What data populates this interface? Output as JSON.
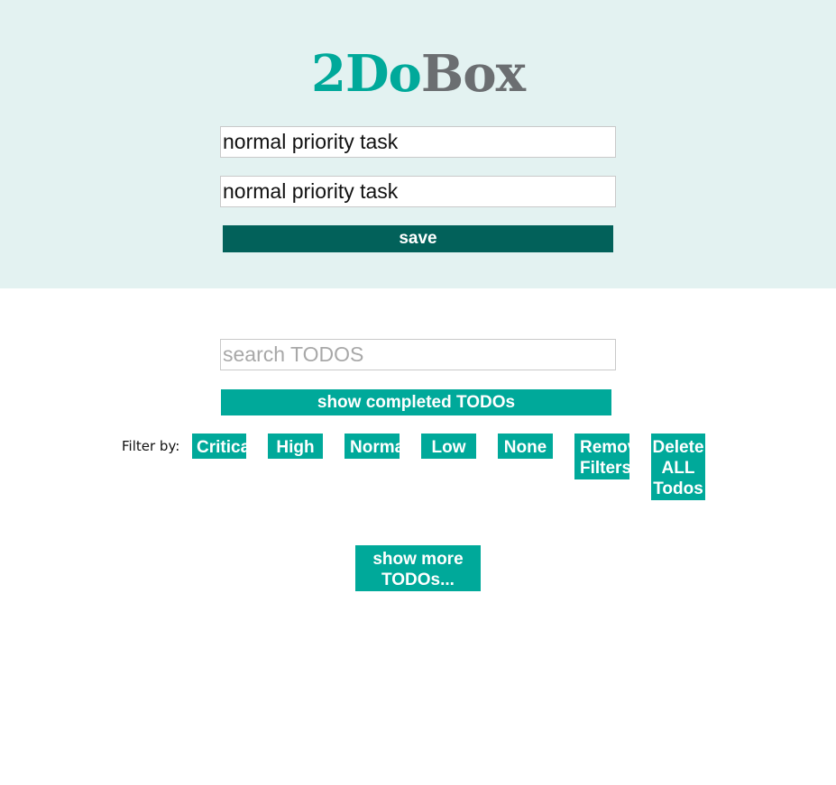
{
  "header": {
    "logo_part_a": "2Do",
    "logo_part_b": "Box",
    "title_value": "normal priority task",
    "body_value": "normal priority task",
    "save_label": "save"
  },
  "search": {
    "placeholder": "search TODOS"
  },
  "show_completed_label": "show completed TODOs",
  "filters": {
    "label": "Filter by:",
    "critical": "Critical",
    "high": "High",
    "normal": "Normal",
    "low": "Low",
    "none": "None",
    "remove": "Remove\nFilters",
    "delete_all": "Delete\nALL\nTodos"
  },
  "show_more_label": "show more\nTODOs...",
  "colors": {
    "header_bg": "#e3f2f1",
    "accent": "#00a99a",
    "save_button": "#02615a",
    "logo_gray": "#6b6e71"
  }
}
